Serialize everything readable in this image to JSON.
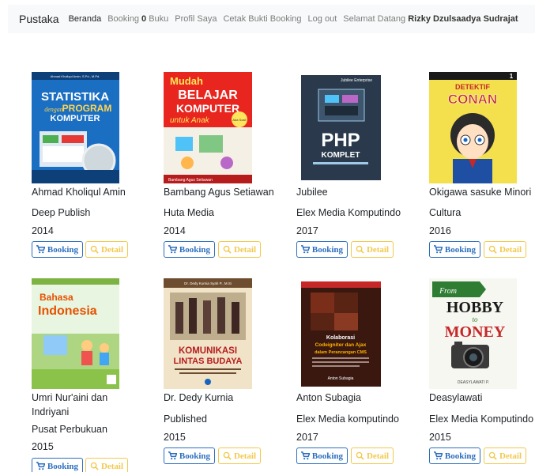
{
  "nav": {
    "brand": "Pustaka",
    "beranda": "Beranda",
    "booking_prefix": "Booking",
    "booking_count": "0",
    "booking_suffix": "Buku",
    "profil": "Profil Saya",
    "cetak": "Cetak Bukti Booking",
    "logout": "Log out",
    "welcome_prefix": "Selamat Datang",
    "user_name": "Rizky Dzulsaadya Sudrajat"
  },
  "buttons": {
    "booking": "Booking",
    "detail": "Detail"
  },
  "books": [
    {
      "author": "Ahmad Kholiqul Amin",
      "publisher": "Deep Publish",
      "year": "2014",
      "cover": {
        "top_text": "Ahmad Kholiqul Amin, S.Pd., M.Pd.",
        "title1": "STATISTIKA",
        "subtitle": "dengan",
        "title2": "PROGRAM",
        "title3": "KOMPUTER"
      }
    },
    {
      "author": "Bambang Agus Setiawan",
      "publisher": "Huta Media",
      "year": "2014",
      "cover": {
        "title1": "Mudah",
        "title2": "BELAJAR",
        "title3": "KOMPUTER",
        "title4": "untuk Anak",
        "badge": "Ada Soal!",
        "footer": "Bambang Agus Setiawan"
      }
    },
    {
      "author": "Jubilee",
      "publisher": "Elex Media Komputindo",
      "year": "2017",
      "cover": {
        "top_text": "Jubilee Enterprise",
        "title1": "PHP",
        "title2": "KOMPLET"
      }
    },
    {
      "author": "Okigawa sasuke Minori",
      "publisher": "Cultura",
      "year": "2016",
      "cover": {
        "title1": "DETEKTIF",
        "title2": "CONAN",
        "volume": "1"
      }
    },
    {
      "author_line1": "Umri Nur'aini dan",
      "author_line2": "Indriyani",
      "publisher": "Pusat Perbukuan",
      "year": "2015",
      "cover": {
        "title1": "Bahasa",
        "title2": "Indonesia"
      }
    },
    {
      "author": "Dr. Dedy Kurnia",
      "publisher": "Published",
      "year": "2015",
      "cover": {
        "top_text": "Dr. Dedy Kurnia Syah P., M.Si",
        "title1": "KOMUNIKASI",
        "title2": "LINTAS BUDAYA"
      }
    },
    {
      "author": "Anton Subagia",
      "publisher": "Elex Media komputindo",
      "year": "2017",
      "cover": {
        "title1": "Kolaborasi",
        "title2": "Codeigniter dan Ajax",
        "title3": "dalam Perancangan CMS",
        "footer": "Anton Subagia"
      }
    },
    {
      "author": "Deasylawati",
      "publisher": "Elex Media Komputindo",
      "year": "2015",
      "cover": {
        "title1": "From",
        "title2": "HOBBY",
        "title3": "to",
        "title4": "MONEY",
        "footer": "DEASYLAWATI P."
      }
    }
  ],
  "colors": {
    "booking": "#2c6fbf",
    "detail": "#f2c94c",
    "navbar_bg": "#f8f9fa"
  }
}
